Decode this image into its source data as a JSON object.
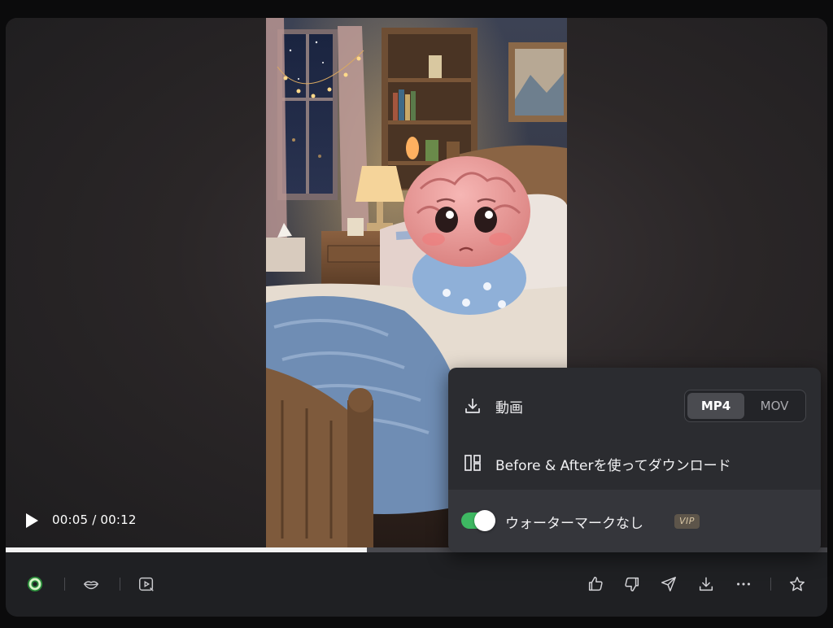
{
  "player": {
    "time_text": "00:05 / 00:12",
    "progress_fraction": 0.44
  },
  "menu": {
    "video_label": "動画",
    "formats": [
      "MP4",
      "MOV"
    ],
    "selected_format": "MP4",
    "before_after_label": "Before & Afterを使ってダウンロード",
    "watermark_label": "ウォーターマークなし",
    "watermark_enabled": true,
    "vip_badge": "VIP"
  },
  "toolbar": {
    "left_icons": [
      "model-logo-icon",
      "lips-icon",
      "play-edit-icon"
    ],
    "right_icons": [
      "thumbs-up-icon",
      "thumbs-down-icon",
      "share-send-icon",
      "download-icon",
      "more-icon",
      "star-icon"
    ]
  },
  "colors": {
    "accent_green": "#3eb862",
    "panel_bg": "#2b2c30",
    "page_bg": "#0b0b0c",
    "card_bg": "#1f2023"
  }
}
